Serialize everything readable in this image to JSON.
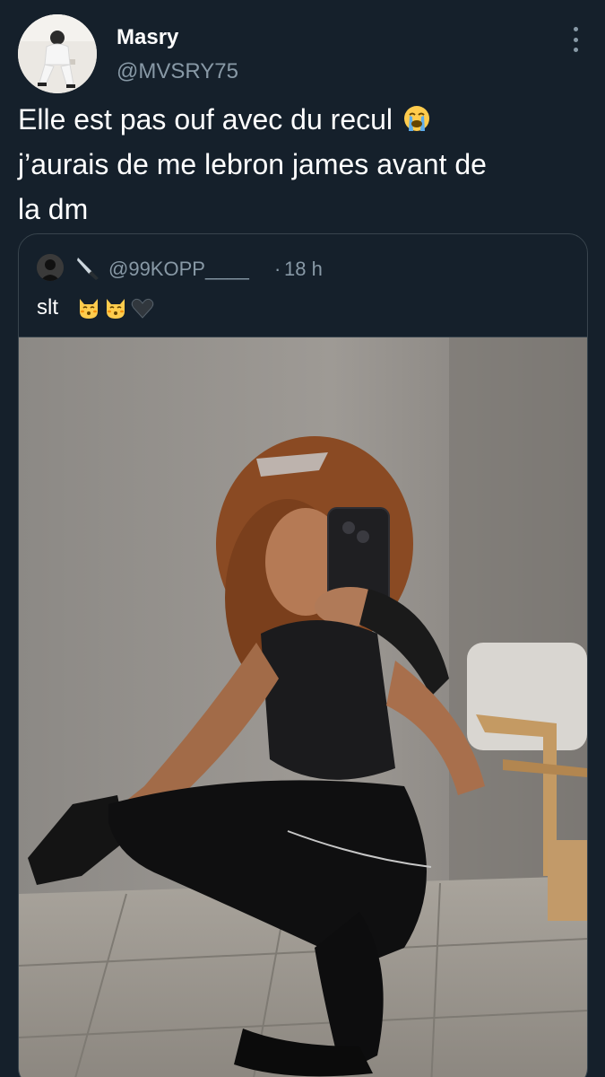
{
  "tweet": {
    "author_name": "Masry",
    "author_handle": "@MVSRY75",
    "text_line1": "Elle est pas ouf avec du recul",
    "text_line2": "j’aurais de me lebron james avant de",
    "text_line3": "la dm",
    "emoji": "loudly-crying-face-emoji",
    "more_icon": "more-vertical-icon"
  },
  "quoted_tweet": {
    "handle": "@99KOPP____",
    "separator": "·",
    "time": "18 h",
    "text": "slt",
    "handle_emoji": "knife-emoji",
    "text_emojis": [
      "kissing-cat-emoji",
      "kissing-cat-emoji",
      "black-heart-emoji"
    ]
  },
  "colors": {
    "background": "#15202b",
    "text_primary": "#ffffff",
    "text_secondary": "#8899a6",
    "border": "#38444d"
  }
}
